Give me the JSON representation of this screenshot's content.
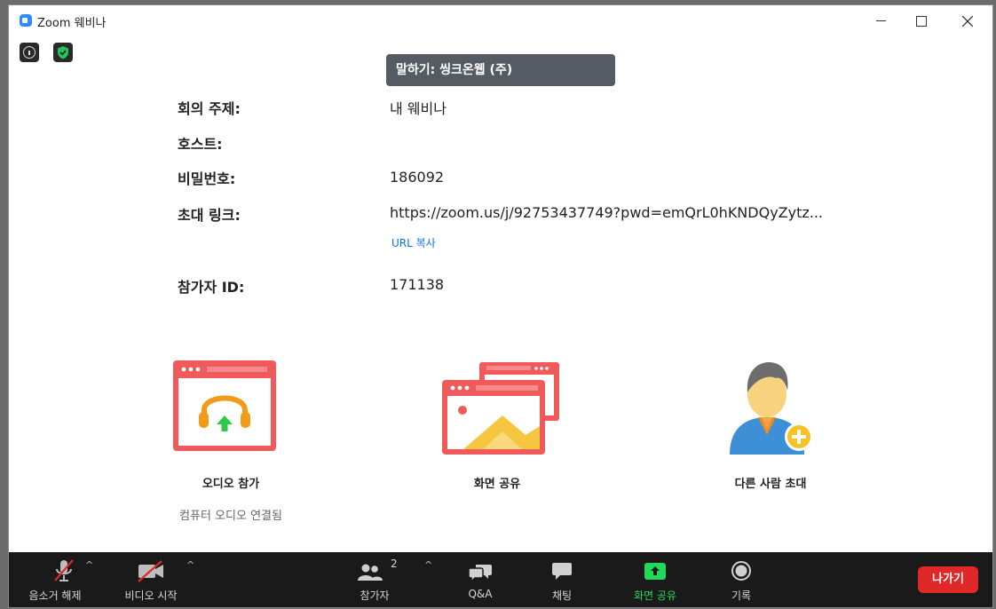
{
  "window": {
    "title": "Zoom 웨비나"
  },
  "speaking": {
    "text": "말하기: 씽크온웹 (주)"
  },
  "meeting_info": {
    "topic_label": "회의 주제:",
    "topic_value": "내 웨비나",
    "host_label": "호스트:",
    "host_value": "",
    "password_label": "비밀번호:",
    "password_value": "186092",
    "invite_label": "초대 링크:",
    "invite_value": "https://zoom.us/j/92753437749?pwd=emQrL0hKNDQyZytz...",
    "copy_url_label": "URL 복사",
    "participant_id_label": "참가자 ID:",
    "participant_id_value": "171138"
  },
  "actions": {
    "join_audio_label": "오디오 참가",
    "join_audio_status": "컴퓨터 오디오 연결됨",
    "share_screen_label": "화면 공유",
    "invite_label": "다른 사람 초대"
  },
  "toolbar": {
    "unmute_label": "음소거 해제",
    "start_video_label": "비디오 시작",
    "participants_label": "참가자",
    "participants_count": "2",
    "qa_label": "Q&A",
    "chat_label": "채팅",
    "share_label": "화면 공유",
    "record_label": "기록",
    "leave_label": "나가기"
  },
  "colors": {
    "accent_blue": "#0e72ed",
    "share_green": "#23d959",
    "leave_red": "#e02828",
    "tile_red": "#f15a5a"
  }
}
